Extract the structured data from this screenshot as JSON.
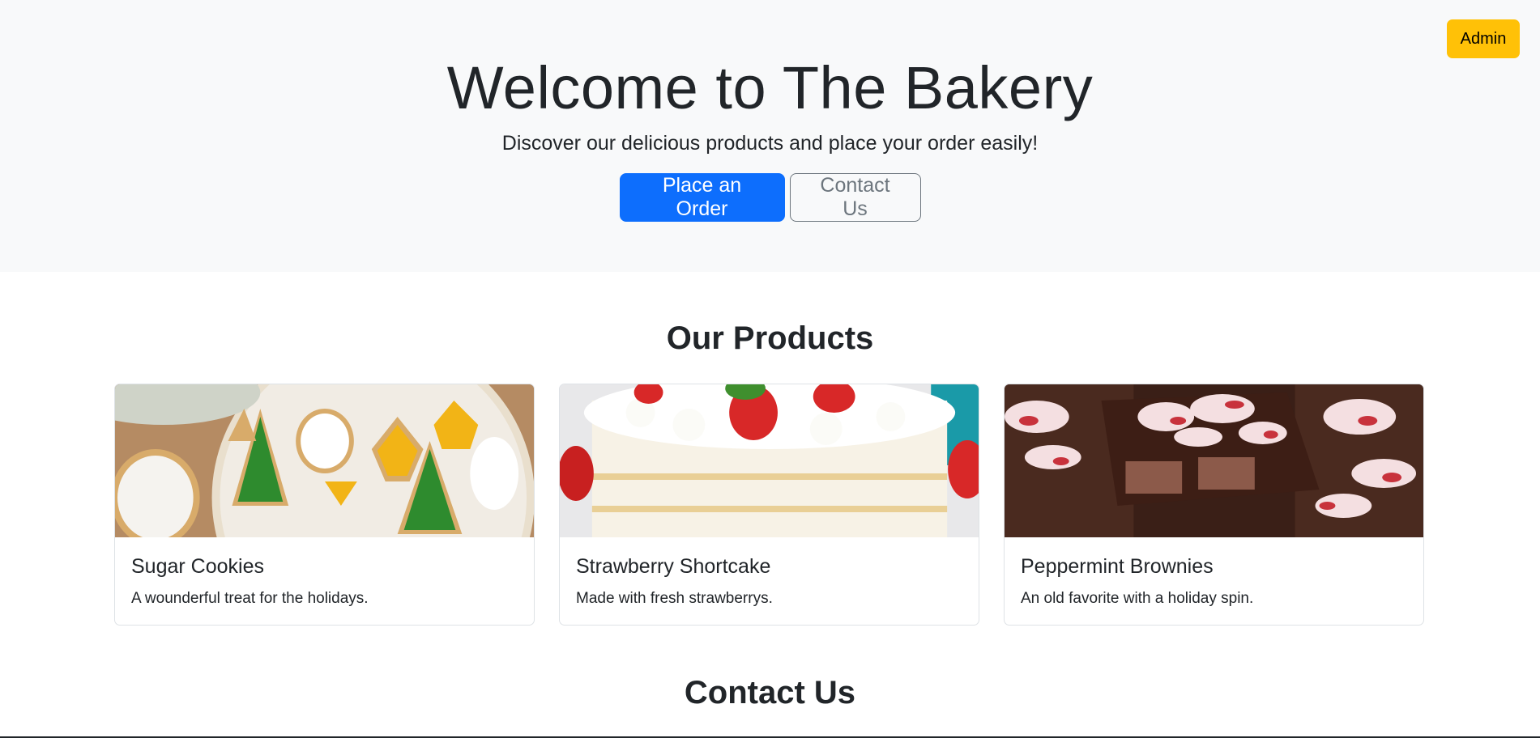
{
  "header": {
    "admin_label": "Admin",
    "title": "Welcome to The Bakery",
    "lead": "Discover our delicious products and place your order easily!",
    "primary_action": "Place an Order",
    "secondary_action": "Contact Us"
  },
  "products": {
    "heading": "Our Products",
    "items": [
      {
        "title": "Sugar Cookies",
        "description": "A wounderful treat for the holidays."
      },
      {
        "title": "Strawberry Shortcake",
        "description": "Made with fresh strawberrys."
      },
      {
        "title": "Peppermint Brownies",
        "description": "An old favorite with a holiday spin."
      }
    ]
  },
  "contact": {
    "heading": "Contact Us"
  },
  "colors": {
    "hero_bg": "#f8f9fa",
    "primary": "#0d6efd",
    "warning": "#ffc107",
    "secondary": "#6c757d"
  }
}
